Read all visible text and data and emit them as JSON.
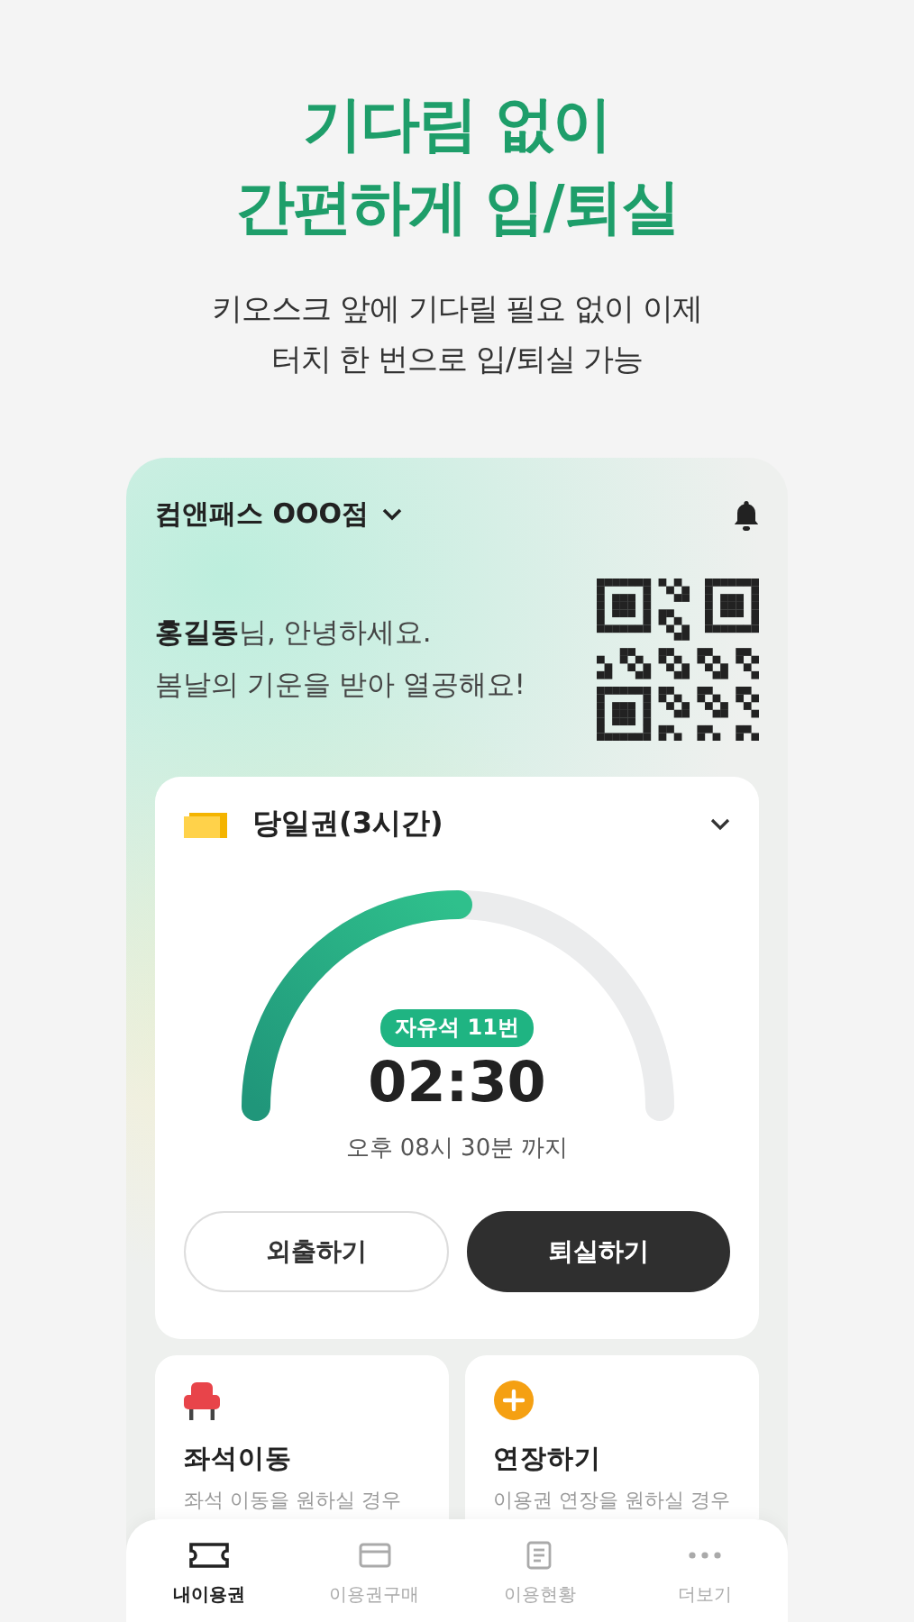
{
  "headline": [
    "기다림 없이",
    "간편하게 입/퇴실"
  ],
  "subtitle": [
    "키오스크 앞에 기다릴 필요 없이 이제",
    "터치 한 번으로 입/퇴실 가능"
  ],
  "store": {
    "name": "컴앤패스 OOO점"
  },
  "greeting": {
    "line_1": "**홍길동**님, 안녕하세요.",
    "line_2": "봄날의 기운을 받아 열공해요!"
  },
  "ticket": {
    "title": "당일권(3시간)",
    "seat": "자유석 11번",
    "remaining": "02:30",
    "until": "오후 08시 30분 까지",
    "level": 0.5
  },
  "buttons": [
    {
      "label": "외출하기",
      "kind": "outline"
    },
    {
      "label": "퇴실하기",
      "kind": "filled"
    }
  ],
  "actions": [
    {
      "kind": "seat",
      "title": "좌석이동",
      "desc": "좌석 이동을 원하실 경우"
    },
    {
      "kind": "extend",
      "title": "연장하기",
      "desc": "이용권 연장을 원하실 경우"
    }
  ],
  "nav": [
    {
      "kind": "ticket",
      "label": "내이용권",
      "selected": true
    },
    {
      "kind": "card",
      "label": "이용권구매",
      "selected": false
    },
    {
      "kind": "doc",
      "label": "이용현황",
      "selected": false
    },
    {
      "kind": "more",
      "label": "더보기",
      "selected": false
    }
  ]
}
